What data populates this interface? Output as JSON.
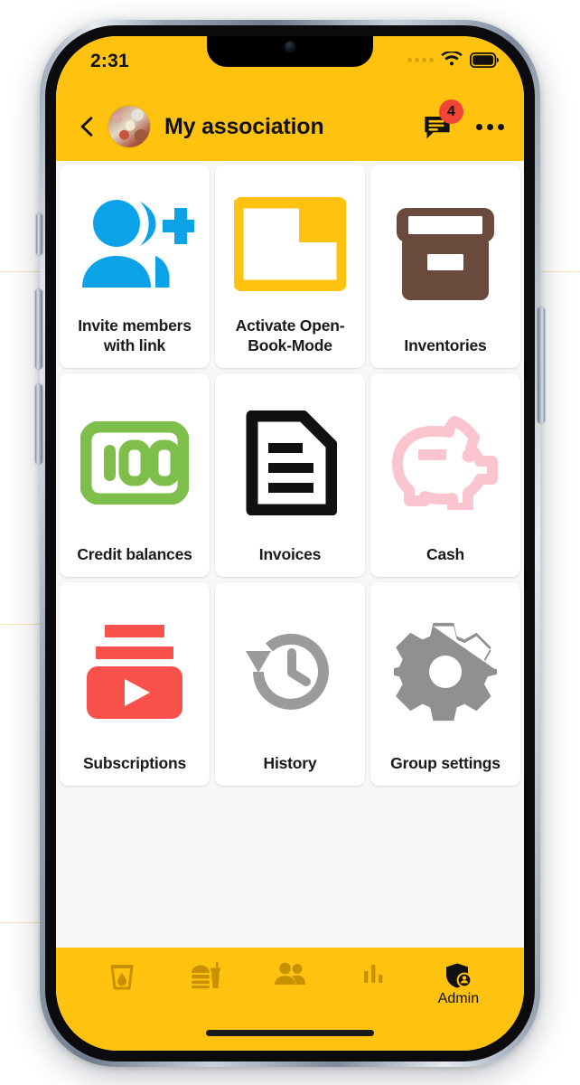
{
  "status_bar": {
    "time": "2:31",
    "signal_icon": "signal-dots-icon",
    "wifi_icon": "wifi-icon",
    "battery_icon": "battery-full-icon"
  },
  "app_bar": {
    "back_icon": "back-chevron-icon",
    "avatar": "group-avatar-photo",
    "title": "My association",
    "chat_icon": "chat-bubble-icon",
    "chat_badge": "4",
    "overflow_icon": "overflow-menu-icon"
  },
  "colors": {
    "brand_yellow": "#FFC20E",
    "badge_red": "#F04438",
    "invite_blue": "#0CA2E8",
    "folder_yellow": "#FFC20E",
    "inventory_brown": "#6B4A3E",
    "credit_green": "#7DBF4A",
    "invoice_black": "#111111",
    "cash_pink": "#FBC5D0",
    "subscription_red": "#F9524C",
    "history_gray": "#9B9B9B",
    "settings_gray": "#909090",
    "page_bg": "#F7F7F7",
    "tile_bg": "#FFFFFF"
  },
  "grid": {
    "tiles": [
      {
        "label": "Invite members with link",
        "icon": "person-add-icon",
        "color": "#0CA2E8"
      },
      {
        "label": "Activate Open-Book-Mode",
        "icon": "folder-open-icon",
        "color": "#FFC20E"
      },
      {
        "label": "Inventories",
        "icon": "archive-box-icon",
        "color": "#6B4A3E"
      },
      {
        "label": "Credit balances",
        "icon": "hundred-banknote-icon",
        "color": "#7DBF4A"
      },
      {
        "label": "Invoices",
        "icon": "document-lines-icon",
        "color": "#111111"
      },
      {
        "label": "Cash",
        "icon": "piggy-bank-icon",
        "color": "#FBC5D0"
      },
      {
        "label": "Subscriptions",
        "icon": "video-play-stack-icon",
        "color": "#F9524C"
      },
      {
        "label": "History",
        "icon": "clock-rotate-left-icon",
        "color": "#9B9B9B"
      },
      {
        "label": "Group settings",
        "icon": "gear-icon",
        "color": "#909090"
      }
    ]
  },
  "bottom_nav": {
    "items": [
      {
        "label": "",
        "icon": "drink-glass-icon",
        "active": false
      },
      {
        "label": "",
        "icon": "fast-food-icon",
        "active": false
      },
      {
        "label": "",
        "icon": "people-group-icon",
        "active": false
      },
      {
        "label": "",
        "icon": "bar-chart-icon",
        "active": false
      },
      {
        "label": "Admin",
        "icon": "shield-person-icon",
        "active": true
      }
    ]
  }
}
